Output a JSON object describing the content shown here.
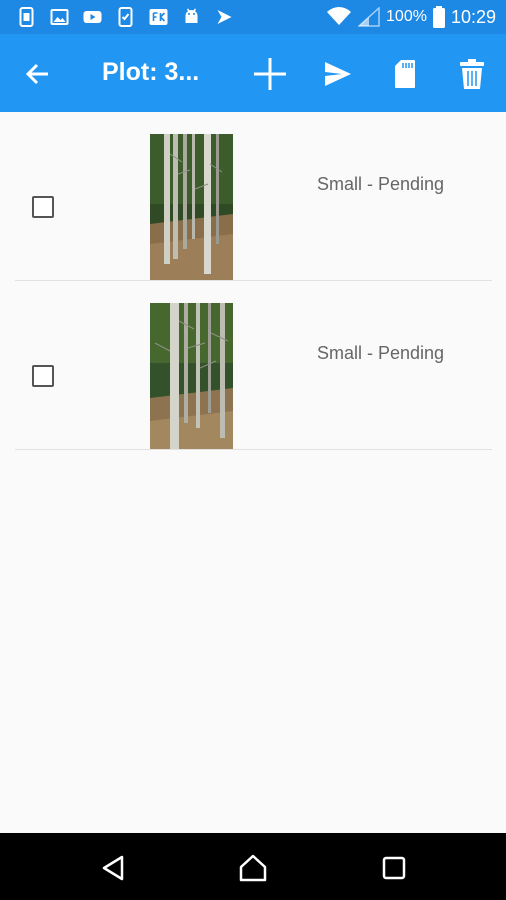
{
  "status_bar": {
    "battery_text": "100%",
    "time": "10:29",
    "icons": [
      "sim-icon",
      "image-icon",
      "youtube-icon",
      "phone-check-icon",
      "fk-app-icon",
      "android-icon",
      "arrow-app-icon",
      "wifi-icon",
      "signal-icon",
      "battery-icon"
    ]
  },
  "app_bar": {
    "title": "Plot: 3...",
    "color": "#2196f3",
    "icons": [
      "back-arrow-icon",
      "add-icon",
      "send-icon",
      "sd-card-icon",
      "trash-icon"
    ]
  },
  "list": {
    "items": [
      {
        "checked": false,
        "status": "Small - Pending"
      },
      {
        "checked": false,
        "status": "Small - Pending"
      }
    ]
  },
  "nav_bar": {
    "icons": [
      "back-triangle-icon",
      "home-icon",
      "recents-icon"
    ]
  }
}
